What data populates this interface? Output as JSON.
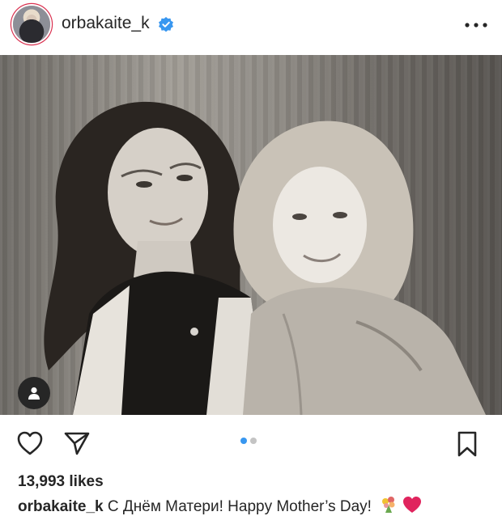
{
  "post": {
    "username": "orbakaite_k",
    "verified": true,
    "likes_text": "13,993 likes",
    "caption_user": "orbakaite_k",
    "caption_text": " С Днём Матери! Happy Mother’s Day! ",
    "carousel": {
      "total": 2,
      "current": 1
    }
  },
  "icons": {
    "header": [
      "avatar",
      "verified-icon",
      "more-options-icon"
    ],
    "actions": [
      "heart-icon",
      "share-icon",
      "bookmark-icon"
    ],
    "photo_overlay": "user-tag-icon",
    "caption_emoji": [
      "bouquet-icon",
      "red-heart-icon"
    ]
  },
  "colors": {
    "verified_blue": "#3897f0",
    "active_dot": "#3897f0",
    "inactive_dot": "#c4c4c4",
    "heart_red": "#e0245e"
  }
}
